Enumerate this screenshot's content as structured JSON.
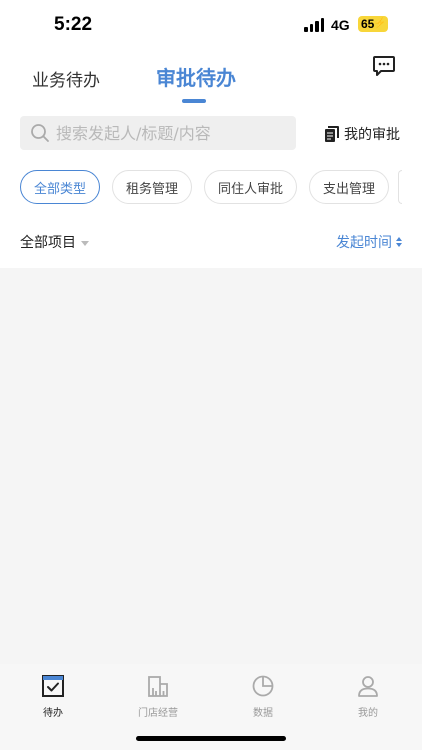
{
  "status_bar": {
    "time": "5:22",
    "network": "4G",
    "battery": "65"
  },
  "tabs": [
    {
      "label": "业务待办",
      "active": false
    },
    {
      "label": "审批待办",
      "active": true
    }
  ],
  "search": {
    "placeholder": "搜索发起人/标题/内容",
    "value": ""
  },
  "my_approval_label": "我的审批",
  "chips": [
    {
      "label": "全部类型",
      "active": true
    },
    {
      "label": "租务管理",
      "active": false
    },
    {
      "label": "同住人审批",
      "active": false
    },
    {
      "label": "支出管理",
      "active": false
    }
  ],
  "filter": {
    "project_label": "全部项目",
    "sort_label": "发起时间"
  },
  "bottom_nav": [
    {
      "label": "待办",
      "icon": "todo-checkbox-icon",
      "active": true
    },
    {
      "label": "门店经营",
      "icon": "store-building-icon",
      "active": false
    },
    {
      "label": "数据",
      "icon": "pie-chart-icon",
      "active": false
    },
    {
      "label": "我的",
      "icon": "user-profile-icon",
      "active": false
    }
  ],
  "colors": {
    "accent": "#4a86d4",
    "battery": "#f8d63a",
    "background": "#f5f5f5"
  }
}
